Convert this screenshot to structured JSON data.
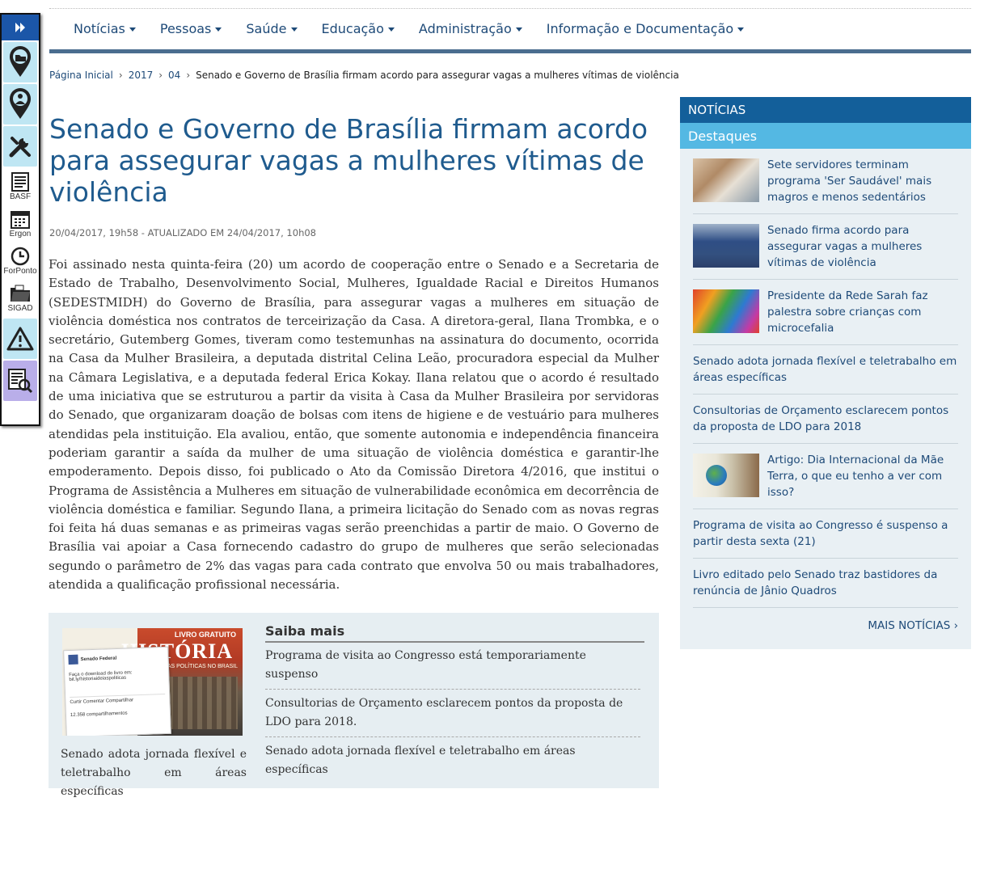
{
  "toolbar": {
    "items": [
      {
        "icon": "expand-icon"
      },
      {
        "icon": "map-pin-folder-icon"
      },
      {
        "icon": "map-pin-person-icon"
      },
      {
        "icon": "tools-icon"
      },
      {
        "icon": "document-icon",
        "label": "BASF"
      },
      {
        "icon": "calendar-icon",
        "label": "Ergon"
      },
      {
        "icon": "clock-icon",
        "label": "ForPonto"
      },
      {
        "icon": "folder-icon",
        "label": "SIGAD"
      },
      {
        "icon": "warning-icon"
      },
      {
        "icon": "search-document-icon"
      }
    ]
  },
  "nav": {
    "items": [
      "Notícias",
      "Pessoas",
      "Saúde",
      "Educação",
      "Administração",
      "Informação e Documentação"
    ]
  },
  "breadcrumb": {
    "items": [
      "Página Inicial",
      "2017",
      "04"
    ],
    "current": "Senado e Governo de Brasília firmam acordo para assegurar vagas a mulheres vítimas de violência"
  },
  "article": {
    "title": "Senado e Governo de Brasília firmam acordo para assegurar vagas a mulheres vítimas de violência",
    "meta": "20/04/2017, 19h58 - ATUALIZADO EM 24/04/2017, 10h08",
    "body": "Foi assinado nesta quinta-feira (20) um acordo de cooperação entre o Senado e a Secretaria de Estado de Trabalho, Desenvolvimento Social, Mulheres, Igualdade Racial e Direitos Humanos (SEDESTMIDH) do Governo de Brasília, para assegurar vagas a mulheres em situação de violência doméstica nos contratos de terceirização da Casa. A diretora-geral, Ilana Trombka, e o secretário, Gutemberg Gomes, tiveram como testemunhas na assinatura do documento, ocorrida na Casa da Mulher Brasileira, a deputada distrital Celina Leão, procuradora especial da Mulher na Câmara Legislativa, e a deputada federal Erica Kokay. Ilana relatou que o acordo é resultado de uma iniciativa que se estruturou a partir da visita à Casa da Mulher Brasileira por servidoras do Senado, que organizaram doação de bolsas com itens de higiene e de vestuário para mulheres atendidas pela instituição. Ela avaliou, então, que somente autonomia e independência financeira poderiam garantir a saída da mulher de uma situação de violência doméstica e garantir-lhe empoderamento. Depois disso, foi publicado o Ato da Comissão Diretora 4/2016, que institui o Programa de Assistência a Mulheres em situação de vulnerabilidade econômica em decorrência de violência doméstica e familiar. Segundo Ilana, a primeira licitação do Senado com as novas regras foi feita há duas semanas e as primeiras vagas serão preenchidas a partir de maio. O Governo de Brasília vai apoiar a Casa fornecendo cadastro do grupo de mulheres que serão selecionadas segundo o parâmetro de 2% das vagas para cada contrato que envolva 50 ou mais trabalhadores, atendida a qualificação profissional necessária."
  },
  "saiba_mais": {
    "image": {
      "book_top": "LIVRO GRATUITO",
      "book_title": "HISTÓRIA",
      "book_subtitle": "DAS IDEIAS POLÍTICAS NO BRASIL",
      "fb_name": "Senado Federal",
      "fb_text": "Faça o download do livro em: bit.ly/historiaideiaspoliticas",
      "fb_actions": "Curtir   Comentar   Compartilhar",
      "fb_shares": "12.358 compartilhamentos"
    },
    "caption": "Senado adota jornada flexível e teletrabalho em áreas específicas",
    "heading": "Saiba mais",
    "links": [
      "Programa de visita ao Congresso está temporariamente suspenso",
      "Consultorias de Orçamento esclarecem pontos da proposta de LDO para 2018.",
      "Senado adota jornada flexível e teletrabalho em áreas específicas"
    ]
  },
  "sidebar": {
    "heading": "NOTÍCIAS",
    "subheading": "Destaques",
    "items": [
      {
        "text": "Sete servidores terminam programa 'Ser Saudável' mais magros e menos sedentários",
        "thumb": "t1"
      },
      {
        "text": "Senado firma acordo para assegurar vagas a mulheres vítimas de violência",
        "thumb": "t2"
      },
      {
        "text": "Presidente da Rede Sarah faz palestra sobre crianças com microcefalia",
        "thumb": "t3"
      },
      {
        "text": "Senado adota jornada flexível e teletrabalho em áreas específicas"
      },
      {
        "text": "Consultorias de Orçamento esclarecem pontos da proposta de LDO para 2018"
      },
      {
        "text": "Artigo: Dia Internacional da Mãe Terra, o que eu tenho a ver com isso?",
        "thumb": "t4"
      },
      {
        "text": "Programa de visita ao Congresso é suspenso a partir desta sexta (21)"
      },
      {
        "text": "Livro editado pelo Senado traz bastidores da renúncia de Jânio Quadros"
      }
    ],
    "more": "MAIS NOTÍCIAS ›"
  }
}
